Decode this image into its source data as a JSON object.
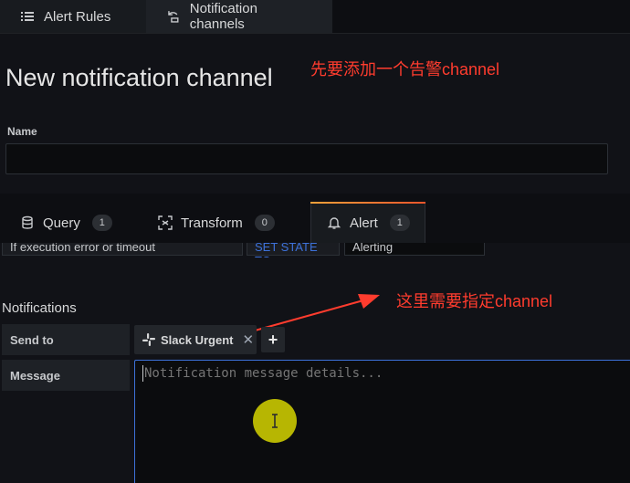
{
  "top_tabs": [
    {
      "label": "Alert Rules",
      "icon": "list-icon"
    },
    {
      "label": "Notification channels",
      "icon": "notification-channel-icon"
    }
  ],
  "page_title": "New notification channel",
  "annotations": {
    "top": "先要添加一个告警channel",
    "middle": "这里需要指定channel",
    "color": "#ff3c2e"
  },
  "name_field": {
    "label": "Name",
    "value": ""
  },
  "panel_tabs": [
    {
      "label": "Query",
      "count": "1",
      "icon": "database-icon"
    },
    {
      "label": "Transform",
      "count": "0",
      "icon": "transform-icon"
    },
    {
      "label": "Alert",
      "count": "1",
      "icon": "bell-icon"
    }
  ],
  "condition_row": {
    "left_text": "If execution error or timeout",
    "mid_text": "SET STATE TO",
    "right_text": "Alerting"
  },
  "notifications": {
    "title": "Notifications",
    "send_to_label": "Send to",
    "channel_chip": "Slack Urgent",
    "add_label": "+",
    "message_label": "Message",
    "message_placeholder": "Notification message details...",
    "message_value": ""
  },
  "colors": {
    "accent_blue": "#3d71d9",
    "cursor_highlight": "#d6d400",
    "alert_tab_gradient_start": "#f4a13a",
    "alert_tab_gradient_end": "#e8552b"
  }
}
